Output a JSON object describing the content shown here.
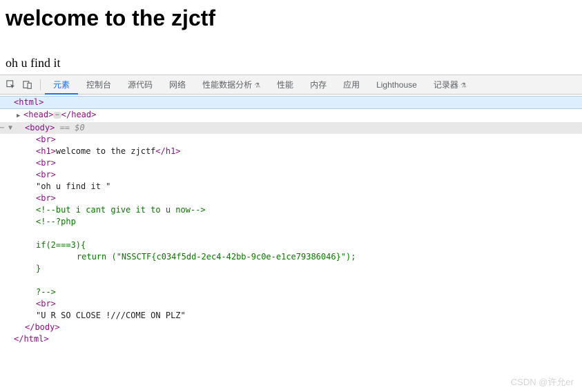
{
  "page": {
    "heading": "welcome to the zjctf",
    "subtext": "oh u find it"
  },
  "devtools": {
    "tabs": {
      "elements": "元素",
      "console": "控制台",
      "sources": "源代码",
      "network": "网络",
      "performance_insights": "性能数据分析",
      "performance": "性能",
      "memory": "内存",
      "application": "应用",
      "lighthouse": "Lighthouse",
      "recorder": "记录器"
    },
    "dom": {
      "html_open": "<html>",
      "head_open": "<head>",
      "head_close": "</head>",
      "body_open": "<body>",
      "sel_hint": " == $0",
      "br": "<br>",
      "h1_open": "<h1>",
      "h1_text": "welcome to the zjctf",
      "h1_close": "</h1>",
      "text1": "\"oh u find it \"",
      "comment1": "<!--but i cant give it to u now-->",
      "php_open": "<!--?php",
      "if_line": "if(2===3){",
      "return_line": "    return (\"NSSCTF{c034f5dd-2ec4-42bb-9c0e-e1ce79386046}\");",
      "brace_close": "}",
      "php_close": "?-->",
      "text2": "\"U R SO CLOSE !///COME ON PLZ\"",
      "body_close": "</body>",
      "html_close": "</html>"
    }
  },
  "watermark": "CSDN @许允er"
}
